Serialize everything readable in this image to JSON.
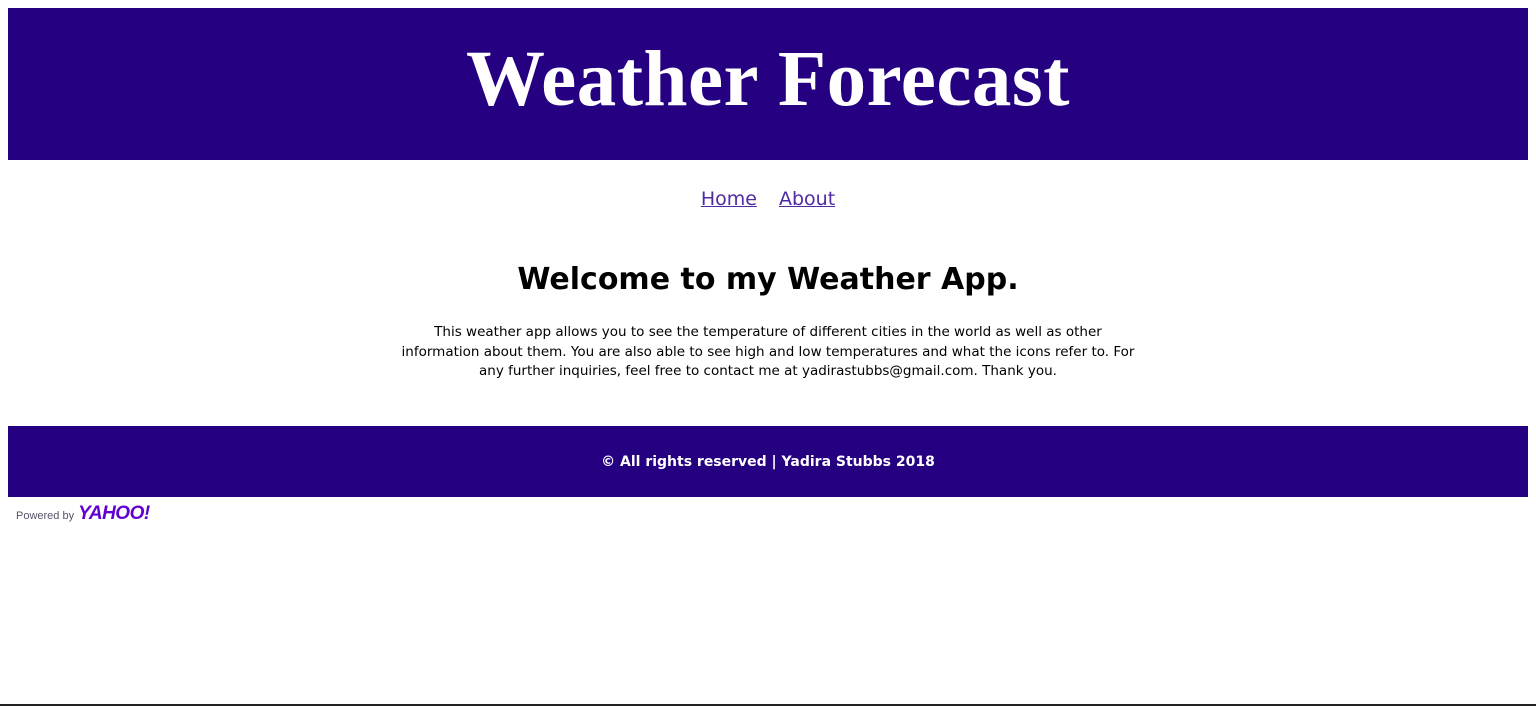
{
  "header": {
    "title": "Weather Forecast"
  },
  "nav": {
    "items": [
      {
        "label": "Home"
      },
      {
        "label": "About"
      }
    ]
  },
  "main": {
    "heading": "Welcome to my Weather App.",
    "intro": "This weather app allows you to see the temperature of different cities in the world as well as other information about them. You are also able to see high and low temperatures and what the icons refer to. For any further inquiries, feel free to contact me at yadirastubbs@gmail.com. Thank you."
  },
  "footer": {
    "text": "© All rights reserved | Yadira Stubbs 2018"
  },
  "attribution": {
    "prefix": "Powered by",
    "brand": "YAHOO!"
  },
  "colors": {
    "brand_bar": "#250081",
    "link": "#4f2aa5",
    "yahoo_purple": "#6001d2"
  }
}
